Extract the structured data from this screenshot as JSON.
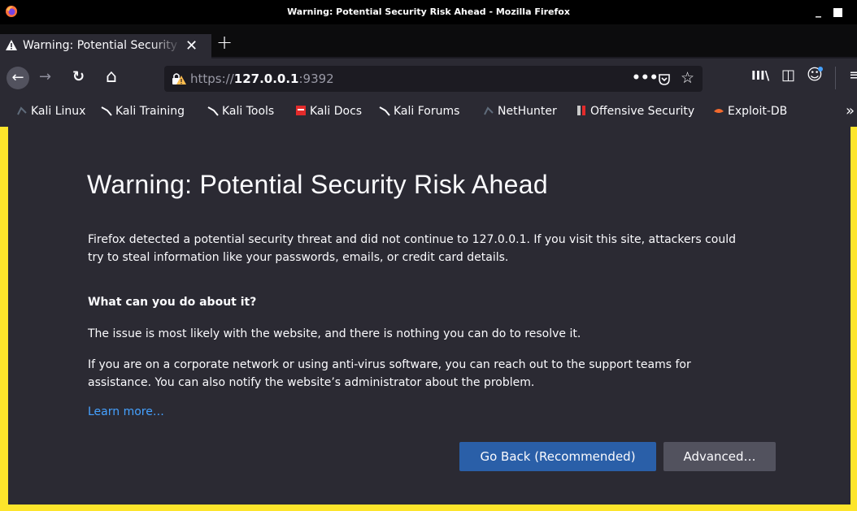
{
  "window": {
    "title": "Warning: Potential Security Risk Ahead - Mozilla Firefox",
    "minimize": "_"
  },
  "tab": {
    "label": "Warning: Potential Security Risk Ahead",
    "close": "✕"
  },
  "newtab": "+",
  "nav": {
    "back": "←",
    "forward": "→",
    "reload": "↻",
    "home": "⌂",
    "url_scheme": "https://",
    "url_host": "127.0.0.1",
    "url_port": ":9392",
    "page_actions": "•••",
    "star": "☆",
    "library": "III\\",
    "sidebar": "◫",
    "account": "☺",
    "menu": "≡"
  },
  "bookmarks": [
    {
      "label": "Kali Linux",
      "icon": "kali-dragon-icon"
    },
    {
      "label": "Kali Training",
      "icon": "kali-dragon-icon"
    },
    {
      "label": "Kali Tools",
      "icon": "kali-dragon-icon"
    },
    {
      "label": "Kali Docs",
      "icon": "kali-docs-icon"
    },
    {
      "label": "Kali Forums",
      "icon": "kali-dragon-icon"
    },
    {
      "label": "NetHunter",
      "icon": "kali-dragon-icon"
    },
    {
      "label": "Offensive Security",
      "icon": "offsec-icon"
    },
    {
      "label": "Exploit-DB",
      "icon": "exploitdb-icon"
    }
  ],
  "bookmarks_overflow": "»",
  "page": {
    "heading": "Warning: Potential Security Risk Ahead",
    "intro_line1": "Firefox detected a potential security threat and did not continue to 127.0.0.1. If you visit this site, attackers could",
    "intro_line2": "try to steal information like your passwords, emails, or credit card details.",
    "subheading": "What can you do about it?",
    "para1": "The issue is most likely with the website, and there is nothing you can do to resolve it.",
    "para2_line1": "If you are on a corporate network or using anti-virus software, you can reach out to the support teams for",
    "para2_line2": "assistance. You can also notify the website’s administrator about the problem.",
    "learn_more": "Learn more…",
    "btn_back": "Go Back (Recommended)",
    "btn_advanced": "Advanced…"
  },
  "colors": {
    "accent_button": "#2a5fa8",
    "link": "#45a1ff",
    "warning_border": "#fde52b",
    "background": "#2b2a33"
  }
}
